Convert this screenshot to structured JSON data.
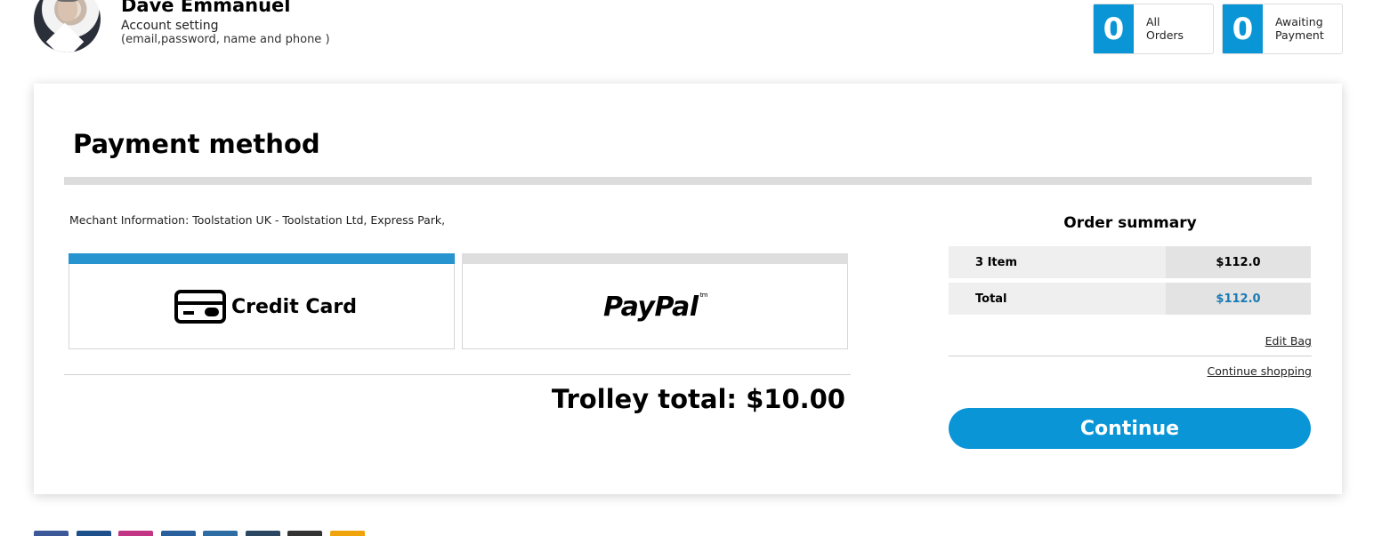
{
  "profile": {
    "name": "Dave Emmanuel",
    "setting_label": "Account setting",
    "setting_hint": "(email,password, name and phone )"
  },
  "stats": [
    {
      "count": "0",
      "label_line1": "All",
      "label_line2": "Orders"
    },
    {
      "count": "0",
      "label_line1": "Awaiting",
      "label_line2": "Payment"
    }
  ],
  "payment": {
    "title": "Payment method",
    "merchant_info": "Mechant Information: Toolstation UK - Toolstation Ltd, Express Park,",
    "methods": [
      {
        "label": "Credit Card",
        "icon": "credit-card-icon",
        "selected": true
      },
      {
        "label": "PayPal",
        "mark": "tm",
        "selected": false
      }
    ],
    "trolley_total": "Trolley total: $10.00"
  },
  "summary": {
    "title": "Order summary",
    "rows": [
      {
        "label": "3 Item",
        "value": "$112.0"
      },
      {
        "label": "Total",
        "value": "$112.0"
      }
    ],
    "edit_bag": "Edit Bag",
    "continue_shopping": "Continue shopping",
    "continue_button": "Continue"
  },
  "colors": {
    "accent": "#0a96d6",
    "selected_strip": "#2894cf",
    "total_value": "#1a7bb6"
  },
  "footer_social": [
    {
      "icon": "facebook-icon",
      "color": "#3b5998"
    },
    {
      "icon": "twitter-icon",
      "color": "#1d4f8a"
    },
    {
      "icon": "instagram-icon",
      "color": "#c13584"
    },
    {
      "icon": "linkedin-icon",
      "color": "#2a5f9e"
    },
    {
      "icon": "share-icon",
      "color": "#2e6da4"
    },
    {
      "icon": "tumblr-icon",
      "color": "#2c4762"
    },
    {
      "icon": "github-icon",
      "color": "#333333"
    },
    {
      "icon": "rss-icon",
      "color": "#f0a30a"
    }
  ]
}
